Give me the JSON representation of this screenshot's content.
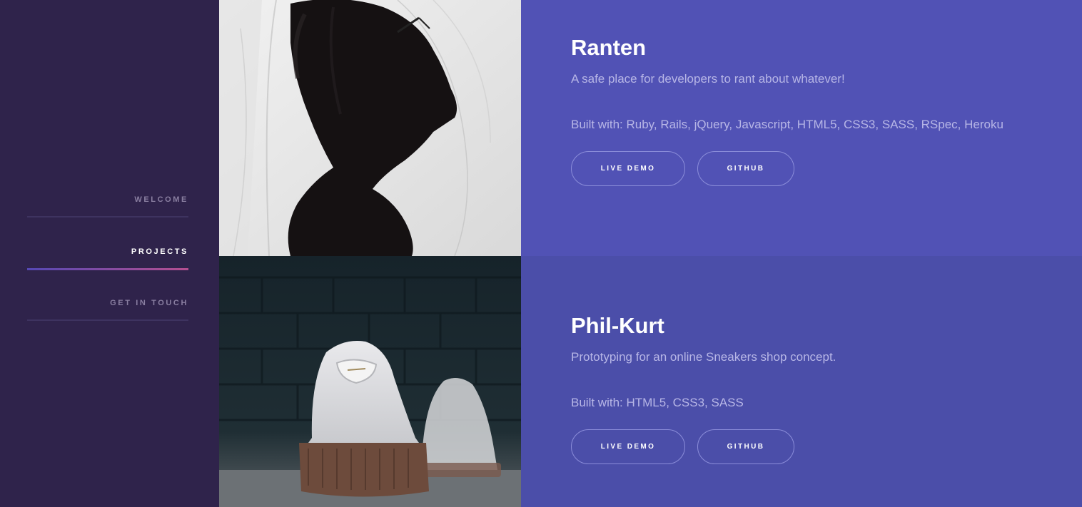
{
  "sidebar": {
    "items": [
      {
        "label": "WELCOME",
        "active": false
      },
      {
        "label": "PROJECTS",
        "active": true
      },
      {
        "label": "GET IN TOUCH",
        "active": false
      }
    ]
  },
  "projects": [
    {
      "title": "Ranten",
      "description": "A safe place for developers to rant about whatever!",
      "built_with": "Built with: Ruby, Rails, jQuery, Javascript, HTML5, CSS3, SASS, RSpec, Heroku",
      "demo_label": "LIVE DEMO",
      "github_label": "GITHUB",
      "image": "veiled-silhouette-photo"
    },
    {
      "title": "Phil-Kurt",
      "description": "Prototyping for an online Sneakers shop concept.",
      "built_with": "Built with: HTML5, CSS3, SASS",
      "demo_label": "LIVE DEMO",
      "github_label": "GITHUB",
      "image": "white-sneakers-photo"
    }
  ],
  "colors": {
    "sidebar_bg": "#2f234b",
    "project_1_bg": "#5152b5",
    "project_2_bg": "#4b4ea9",
    "active_underline_start": "#5548b4",
    "active_underline_end": "#b54f90",
    "text_muted": "#b7b6e6"
  }
}
